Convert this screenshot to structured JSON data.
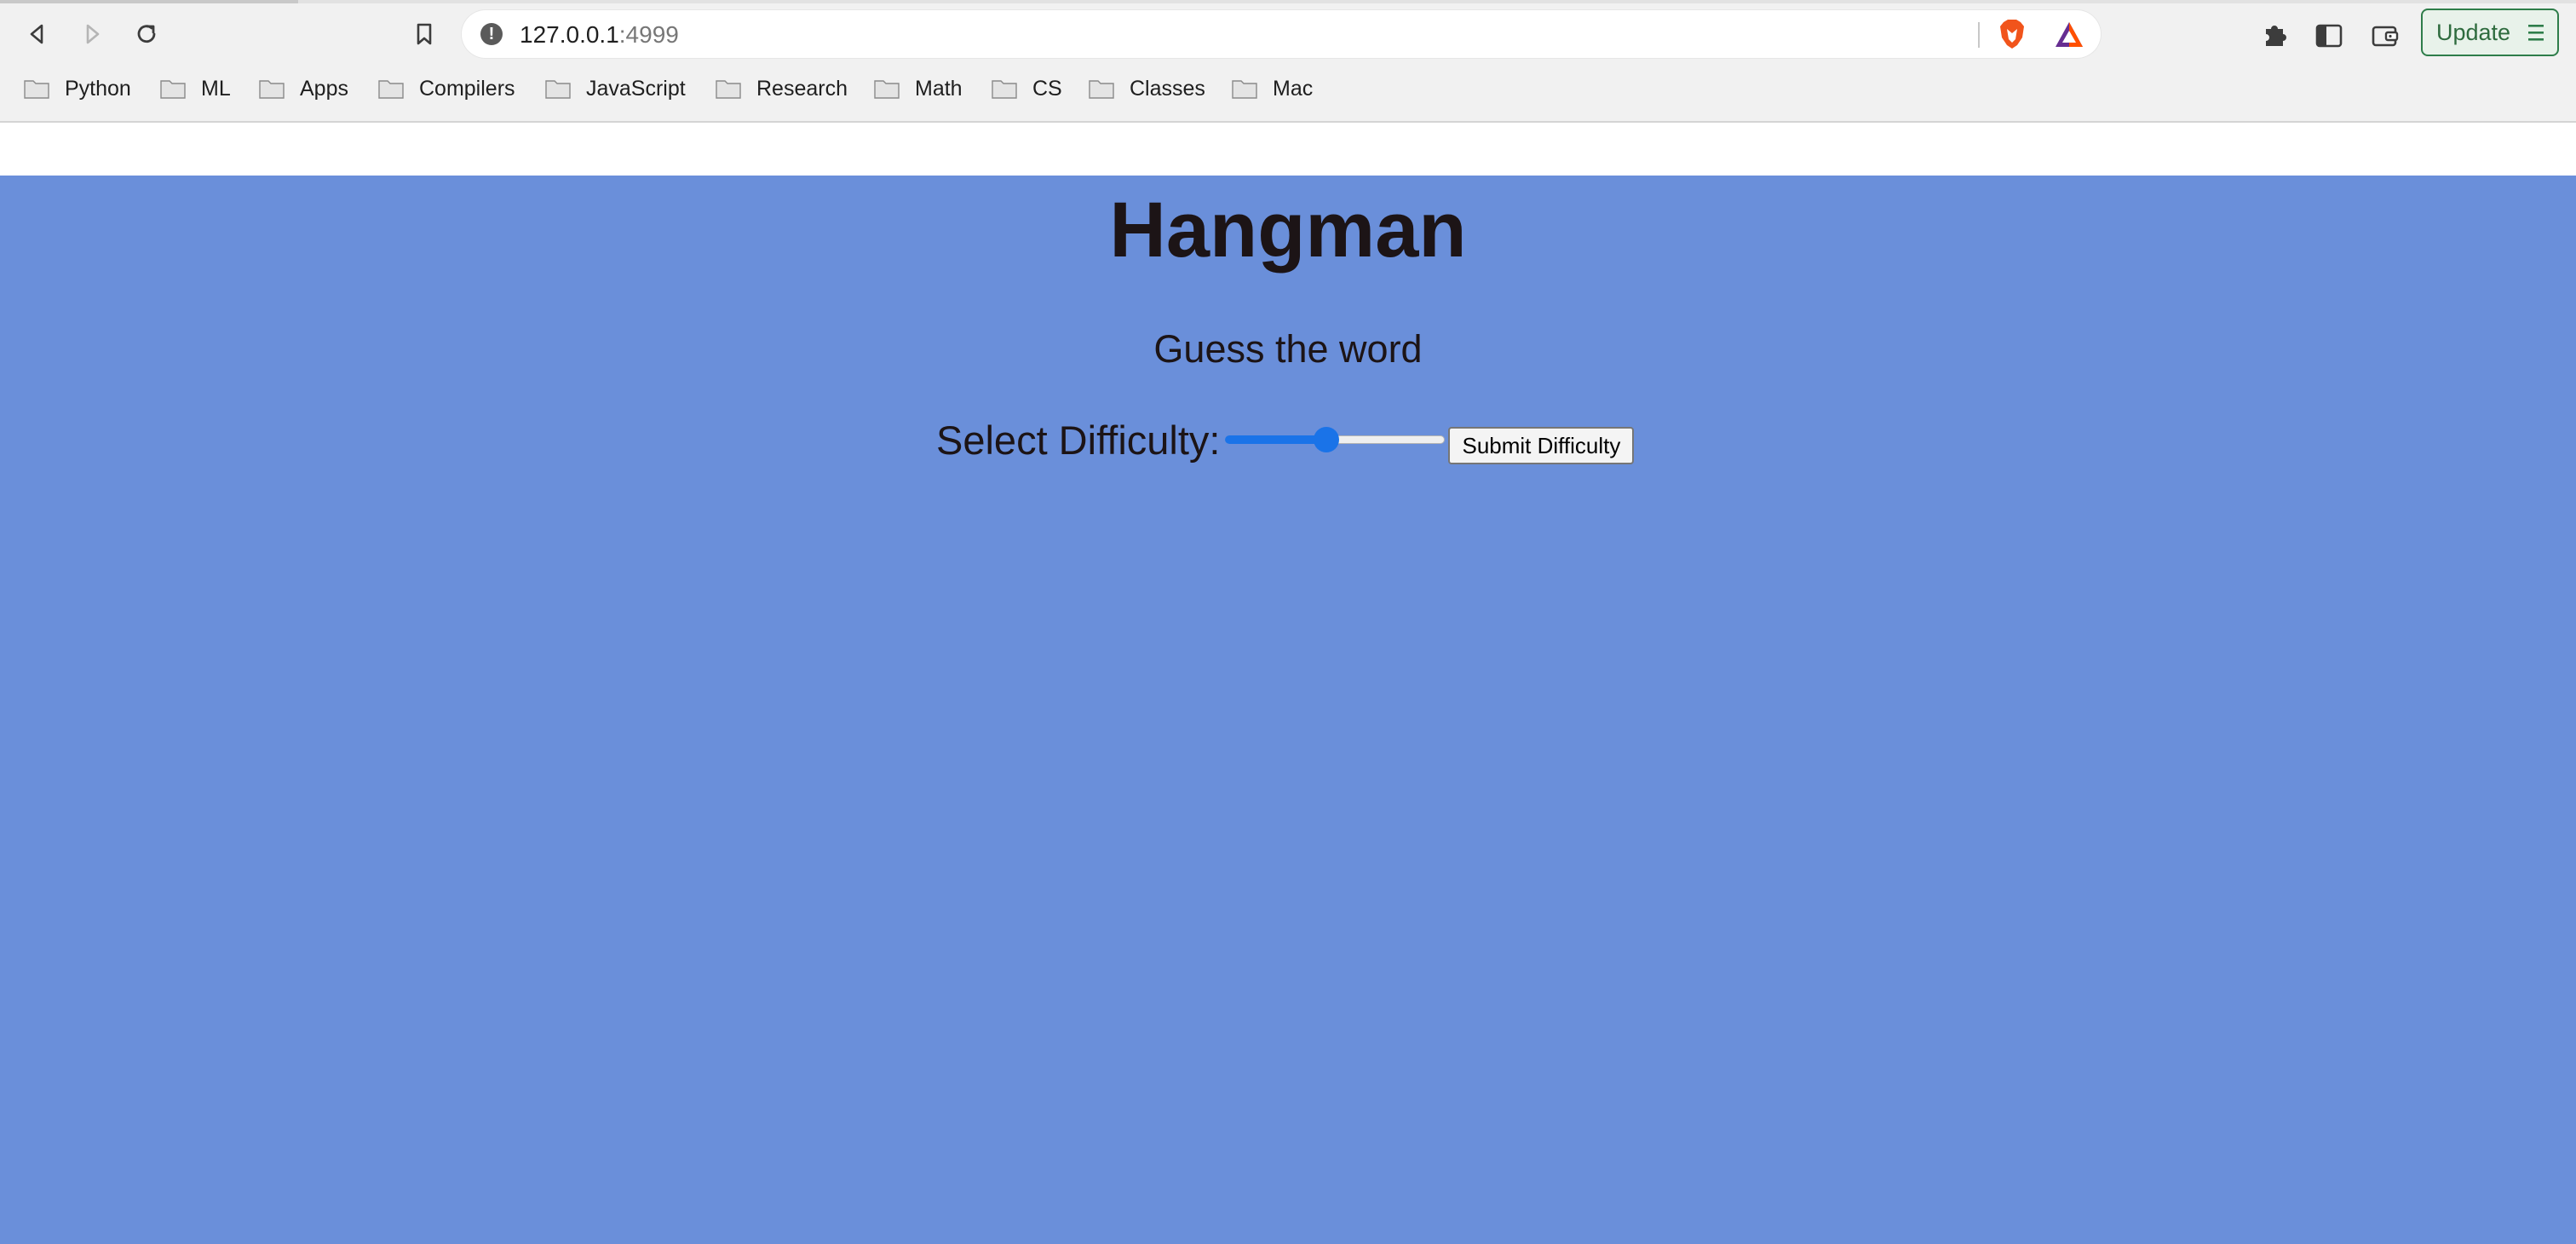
{
  "browser": {
    "url_host": "127.0.0.1",
    "url_port": ":4999",
    "update_label": "Update",
    "bookmarks": [
      {
        "label": "Python"
      },
      {
        "label": "ML"
      },
      {
        "label": "Apps"
      },
      {
        "label": "Compilers"
      },
      {
        "label": "JavaScript"
      },
      {
        "label": "Research"
      },
      {
        "label": "Math"
      },
      {
        "label": "CS"
      },
      {
        "label": "Classes"
      },
      {
        "label": "Mac"
      }
    ]
  },
  "page": {
    "title": "Hangman",
    "subtitle": "Guess the word",
    "difficulty_label": "Select Difficulty:",
    "difficulty_slider_fraction": 0.46,
    "submit_label": "Submit Difficulty",
    "background_color": "#6a8fda"
  },
  "colors": {
    "accent": "#1a73e8",
    "update_green": "#2e7d4a"
  }
}
